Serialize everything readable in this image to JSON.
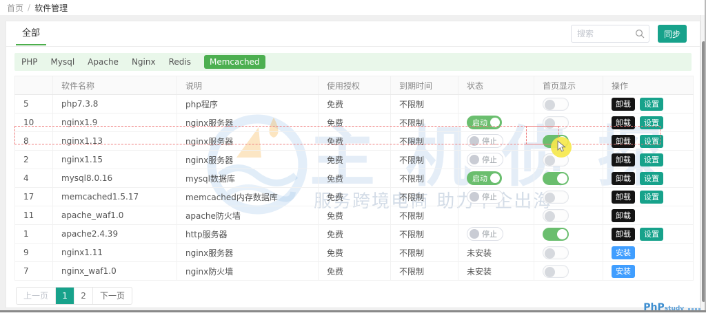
{
  "breadcrumb": {
    "home": "首页",
    "separator": "/",
    "current": "软件管理"
  },
  "tabs": {
    "all": "全部"
  },
  "search": {
    "placeholder": "搜索"
  },
  "sync_button": "同步",
  "filters": {
    "items": [
      "PHP",
      "Mysql",
      "Apache",
      "Nginx",
      "Redis"
    ],
    "active": "Memcached"
  },
  "table": {
    "headers": [
      "",
      "软件名称",
      "说明",
      "使用授权",
      "到期时间",
      "状态",
      "首页显示",
      "操作"
    ],
    "labels": {
      "running": "启动",
      "stopped": "停止",
      "not_installed": "未安装",
      "uninstall": "卸载",
      "settings": "设置",
      "install": "安装"
    },
    "rows": [
      {
        "id": "5",
        "name": "php7.3.8",
        "desc": "php程序",
        "license": "免费",
        "expire": "不限制",
        "status": "none",
        "home": false,
        "actions": [
          "uninstall",
          "settings"
        ]
      },
      {
        "id": "10",
        "name": "nginx1.9",
        "desc": "nginx服务器",
        "license": "免费",
        "expire": "不限制",
        "status": "running",
        "home": false,
        "actions": [
          "uninstall",
          "settings"
        ]
      },
      {
        "id": "8",
        "name": "nginx1.13",
        "desc": "nginx服务器",
        "license": "免费",
        "expire": "不限制",
        "status": "stopped",
        "home": true,
        "actions": [
          "uninstall",
          "settings"
        ],
        "highlighted": true
      },
      {
        "id": "2",
        "name": "nginx1.15",
        "desc": "nginx服务器",
        "license": "免费",
        "expire": "不限制",
        "status": "stopped",
        "home": false,
        "actions": [
          "uninstall",
          "settings"
        ]
      },
      {
        "id": "4",
        "name": "mysql8.0.16",
        "desc": "mysql数据库",
        "license": "免费",
        "expire": "不限制",
        "status": "running",
        "home": true,
        "actions": [
          "uninstall",
          "settings"
        ]
      },
      {
        "id": "17",
        "name": "memcached1.5.17",
        "desc": "memcached内存数据库",
        "license": "免费",
        "expire": "不限制",
        "status": "stopped",
        "home": false,
        "actions": [
          "uninstall",
          "settings"
        ]
      },
      {
        "id": "11",
        "name": "apache_waf1.0",
        "desc": "apache防火墙",
        "license": "免费",
        "expire": "不限制",
        "status": "none",
        "home": false,
        "actions": [
          "uninstall"
        ]
      },
      {
        "id": "1",
        "name": "apache2.4.39",
        "desc": "http服务器",
        "license": "免费",
        "expire": "不限制",
        "status": "stopped",
        "home": true,
        "actions": [
          "uninstall",
          "settings"
        ]
      },
      {
        "id": "9",
        "name": "nginx1.11",
        "desc": "nginx服务器",
        "license": "免费",
        "expire": "不限制",
        "status": "not_installed",
        "home": false,
        "actions": [
          "install"
        ]
      },
      {
        "id": "7",
        "name": "nginx_waf1.0",
        "desc": "nginx防火墙",
        "license": "免费",
        "expire": "不限制",
        "status": "not_installed",
        "home": false,
        "actions": [
          "install"
        ]
      }
    ]
  },
  "pagination": {
    "prev": "上一页",
    "pages": [
      "1",
      "2"
    ],
    "active": "1",
    "next": "下一页"
  },
  "watermark": {
    "title": "主机侦探",
    "tagline": "服务跨境电商 助力中企出海"
  },
  "footer_logo": {
    "text": "PhP",
    "suffix": "study"
  },
  "colors": {
    "teal": "#17a28b",
    "tag_green": "#4caf50",
    "toggle_green": "#6abe6e",
    "install_blue": "#409eff",
    "uninstall_dark": "#141414",
    "filter_bg": "#e9f7ea",
    "highlight_red": "#ef7b7b",
    "cursor_yellow": "#f6e84d"
  }
}
